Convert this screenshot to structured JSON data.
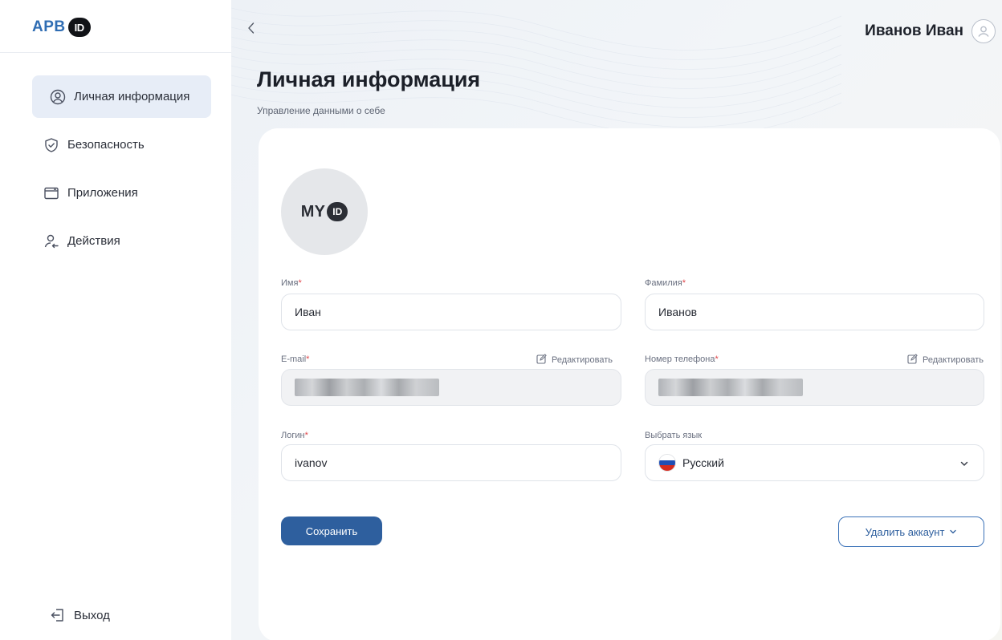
{
  "brand": {
    "logo_text": "АРВ",
    "logo_badge": "ID"
  },
  "sidebar": {
    "items": [
      {
        "label": "Личная информация",
        "icon": "user-circle-icon",
        "active": true
      },
      {
        "label": "Безопасность",
        "icon": "shield-check-icon",
        "active": false
      },
      {
        "label": "Приложения",
        "icon": "window-icon",
        "active": false
      },
      {
        "label": "Действия",
        "icon": "user-activity-icon",
        "active": false
      }
    ],
    "logout_label": "Выход"
  },
  "header": {
    "user_name": "Иванов Иван"
  },
  "page": {
    "title": "Личная информация",
    "subtitle": "Управление данными о себе"
  },
  "avatar": {
    "text": "MY",
    "badge": "ID"
  },
  "form": {
    "required_mark": "*",
    "first_name": {
      "label": "Имя",
      "value": "Иван"
    },
    "last_name": {
      "label": "Фамилия",
      "value": "Иванов"
    },
    "email": {
      "label": "E-mail",
      "edit_label": "Редактировать"
    },
    "phone": {
      "label": "Номер телефона",
      "edit_label": "Редактировать"
    },
    "login": {
      "label": "Логин",
      "value": "ivanov"
    },
    "language": {
      "label": "Выбрать язык",
      "value": "Русский"
    }
  },
  "actions": {
    "save_label": "Сохранить",
    "delete_label": "Удалить аккаунт"
  },
  "colors": {
    "accent": "#2e5f9e",
    "brand": "#2f6db3",
    "active_nav": "#e7edf7",
    "required": "#e0464a"
  }
}
